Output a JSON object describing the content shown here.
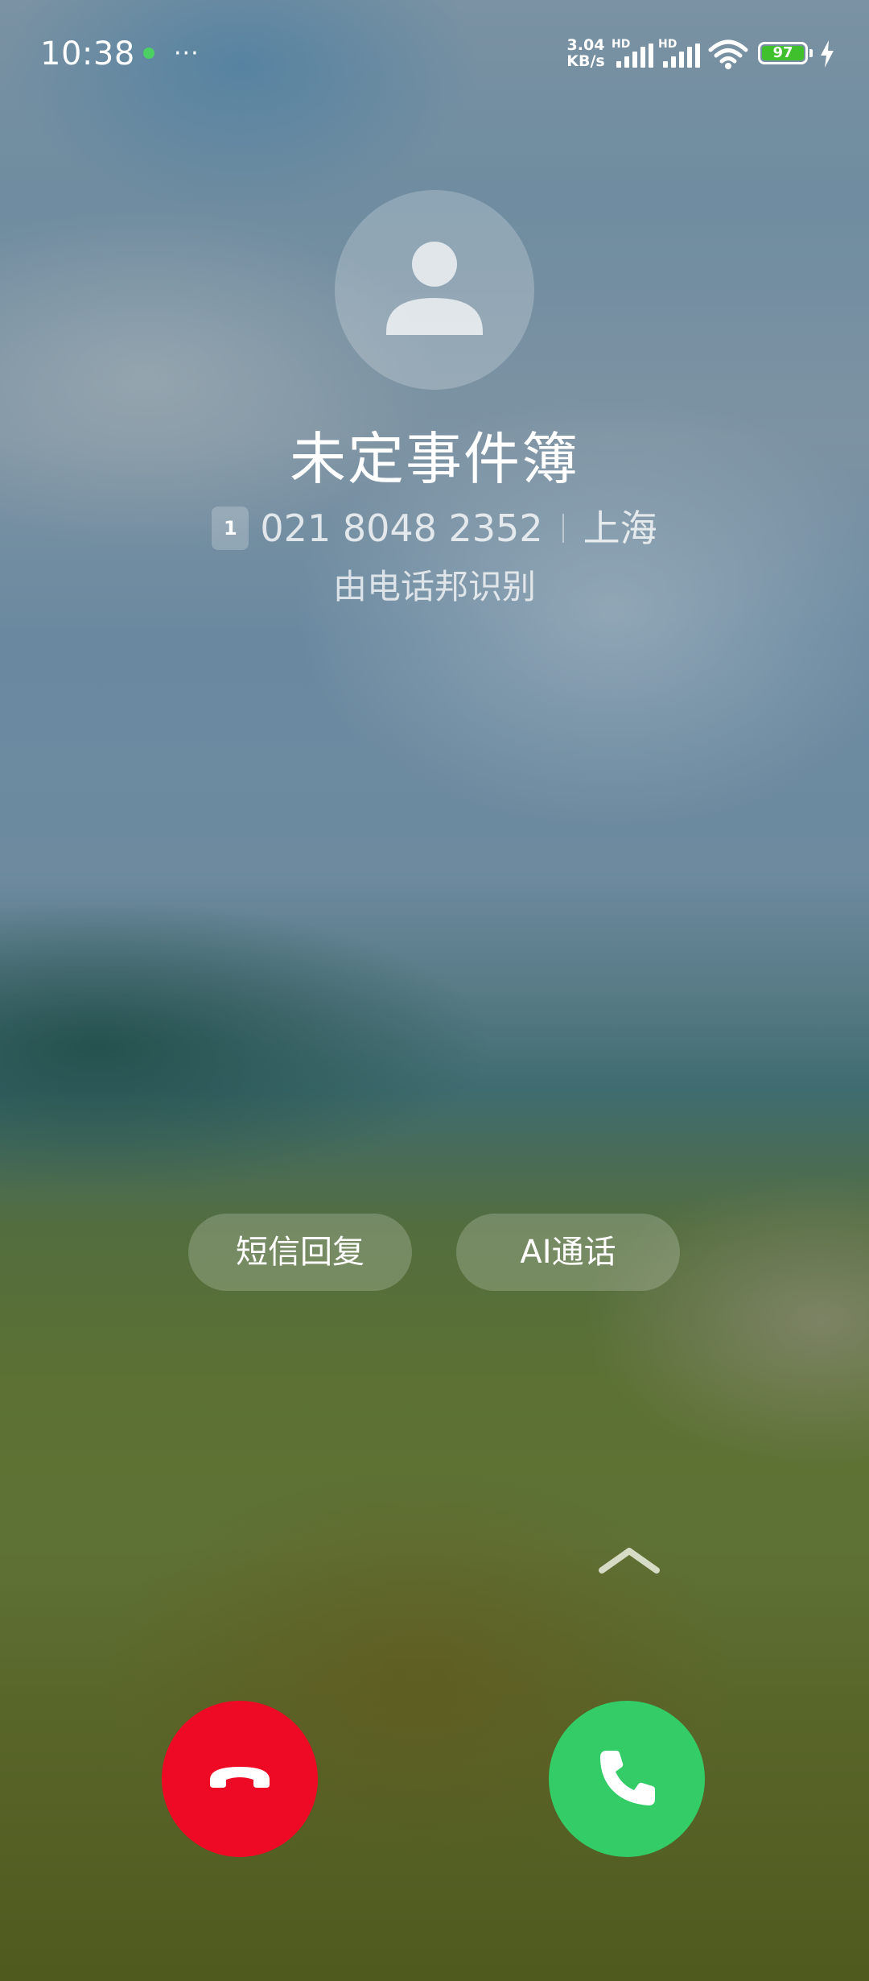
{
  "status_bar": {
    "time": "10:38",
    "overflow_indicator": "···",
    "network_speed_value": "3.04",
    "network_speed_unit": "KB/s",
    "sim1_badge": "HD",
    "sim2_badge": "HD",
    "battery_level": "97",
    "icons": [
      "notification-dot",
      "signal-icon",
      "signal-icon",
      "wifi-icon",
      "battery-icon",
      "charging-icon"
    ],
    "colors": {
      "battery": "#3fc02c",
      "notification_dot": "#4ccf63"
    }
  },
  "caller": {
    "avatar_icon": "person-icon",
    "name": "未定事件簿",
    "sim_slot": "1",
    "number": "021 8048 2352",
    "location": "上海",
    "source": "由电话邦识别"
  },
  "quick_actions": {
    "sms_reply": "短信回复",
    "ai_call": "AI通话"
  },
  "call_controls": {
    "swipe_hint_icon": "chevron-up-icon",
    "decline_icon": "phone-hangup-icon",
    "answer_icon": "phone-icon",
    "colors": {
      "decline": "#ee0a24",
      "answer": "#33cc66"
    }
  }
}
